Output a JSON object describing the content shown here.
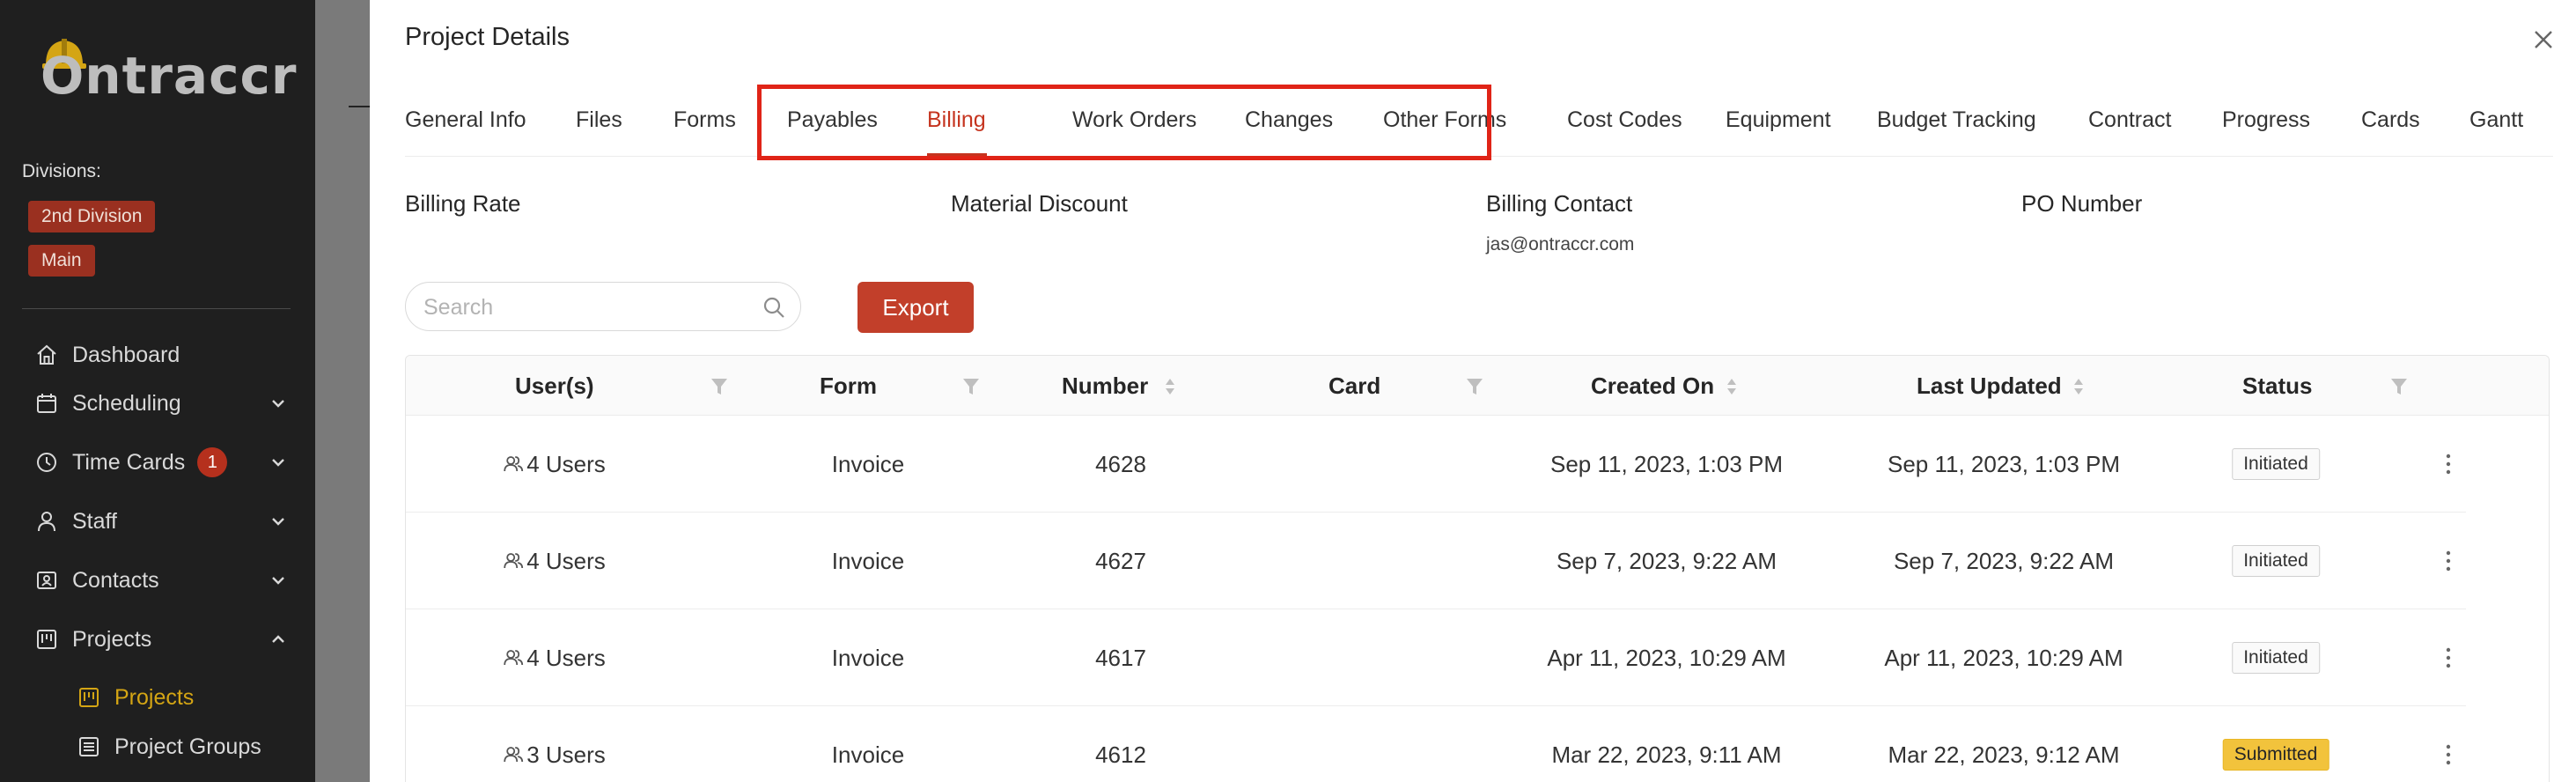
{
  "sidebar": {
    "logo_text": "Ontraccr",
    "divisions_label": "Divisions:",
    "divisions": [
      "2nd Division",
      "Main"
    ],
    "nav": [
      {
        "label": "Dashboard",
        "icon": "home-icon"
      },
      {
        "label": "Scheduling",
        "icon": "calendar-icon"
      },
      {
        "label": "Time Cards",
        "icon": "clock-icon",
        "badge": "1"
      },
      {
        "label": "Staff",
        "icon": "user-icon"
      },
      {
        "label": "Contacts",
        "icon": "contacts-icon"
      },
      {
        "label": "Projects",
        "icon": "projects-icon"
      }
    ],
    "sub_nav": [
      {
        "label": "Projects",
        "icon": "projects-icon",
        "active": true
      },
      {
        "label": "Project Groups",
        "icon": "group-icon"
      }
    ],
    "active_color": "#d4a514"
  },
  "modal": {
    "title": "Project Details",
    "tabs": [
      "General Info",
      "Files",
      "Forms",
      "Payables",
      "Billing",
      "Work Orders",
      "Changes",
      "Other Forms",
      "Cost Codes",
      "Equipment",
      "Budget Tracking",
      "Contract",
      "Progress",
      "Cards",
      "Gantt"
    ],
    "active_tab": "Billing",
    "fields": {
      "billing_rate": {
        "label": "Billing Rate",
        "value": ""
      },
      "material_discount": {
        "label": "Material Discount",
        "value": ""
      },
      "billing_contact": {
        "label": "Billing Contact",
        "value": "jas@ontraccr.com"
      },
      "po_number": {
        "label": "PO Number",
        "value": ""
      }
    },
    "search": {
      "placeholder": "Search"
    },
    "export_label": "Export",
    "accent_color": "#c5341f",
    "highlight_color": "#e02417"
  },
  "table": {
    "columns": [
      "User(s)",
      "Form",
      "Number",
      "Card",
      "Created On",
      "Last Updated",
      "Status"
    ],
    "rows": [
      {
        "users": "4 Users",
        "form": "Invoice",
        "number": "4628",
        "card": "",
        "created": "Sep 11, 2023, 1:03 PM",
        "updated": "Sep 11, 2023, 1:03 PM",
        "status": "Initiated"
      },
      {
        "users": "4 Users",
        "form": "Invoice",
        "number": "4627",
        "card": "",
        "created": "Sep 7, 2023, 9:22 AM",
        "updated": "Sep 7, 2023, 9:22 AM",
        "status": "Initiated"
      },
      {
        "users": "4 Users",
        "form": "Invoice",
        "number": "4617",
        "card": "",
        "created": "Apr 11, 2023, 10:29 AM",
        "updated": "Apr 11, 2023, 10:29 AM",
        "status": "Initiated"
      },
      {
        "users": "3 Users",
        "form": "Invoice",
        "number": "4612",
        "card": "",
        "created": "Mar 22, 2023, 9:11 AM",
        "updated": "Mar 22, 2023, 9:12 AM",
        "status": "Submitted"
      }
    ]
  }
}
